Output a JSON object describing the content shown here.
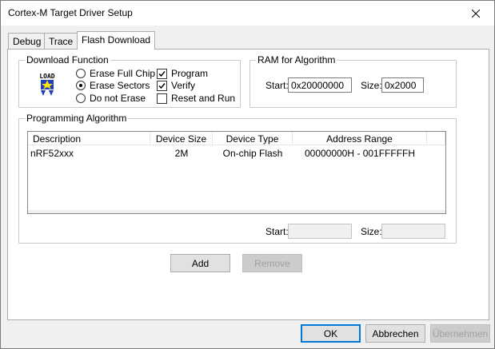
{
  "window": {
    "title": "Cortex-M Target Driver Setup"
  },
  "tabs": [
    {
      "label": "Debug",
      "active": false
    },
    {
      "label": "Trace",
      "active": false
    },
    {
      "label": "Flash Download",
      "active": true
    }
  ],
  "download_function": {
    "title": "Download Function",
    "icon": "load-icon",
    "options": [
      {
        "label": "Erase Full Chip",
        "selected": false
      },
      {
        "label": "Erase Sectors",
        "selected": true
      },
      {
        "label": "Do not Erase",
        "selected": false
      }
    ],
    "checks": [
      {
        "label": "Program",
        "checked": true
      },
      {
        "label": "Verify",
        "checked": true
      },
      {
        "label": "Reset and Run",
        "checked": false
      }
    ]
  },
  "ram": {
    "title": "RAM for Algorithm",
    "start_label": "Start:",
    "start_value": "0x20000000",
    "size_label": "Size:",
    "size_value": "0x2000"
  },
  "programming": {
    "title": "Programming Algorithm",
    "columns": [
      "Description",
      "Device Size",
      "Device Type",
      "Address Range"
    ],
    "rows": [
      [
        "nRF52xxx",
        "2M",
        "On-chip Flash",
        "00000000H - 001FFFFFH"
      ]
    ],
    "start_label": "Start:",
    "start_value": "",
    "size_label": "Size:",
    "size_value": ""
  },
  "actions": {
    "add": "Add",
    "remove": "Remove"
  },
  "footer": {
    "ok": "OK",
    "cancel": "Abbrechen",
    "apply": "Übernehmen"
  }
}
